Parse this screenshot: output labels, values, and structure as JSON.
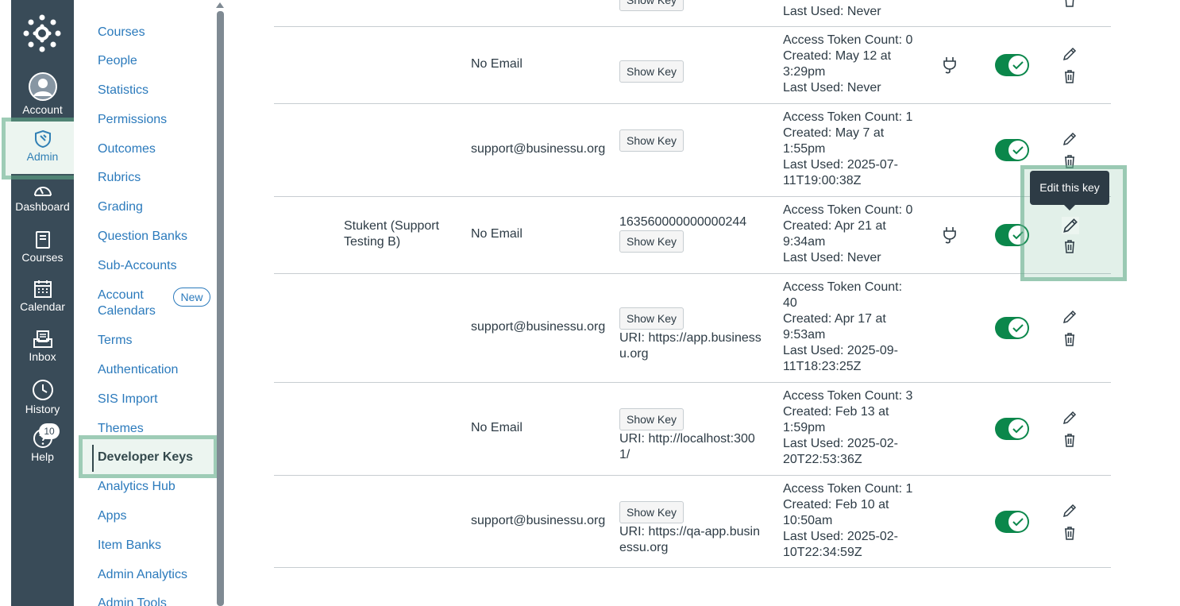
{
  "global_nav": {
    "items": [
      {
        "label": "Account",
        "icon": "account-icon"
      },
      {
        "label": "Admin",
        "icon": "admin-icon"
      },
      {
        "label": "Dashboard",
        "icon": "dashboard-icon"
      },
      {
        "label": "Courses",
        "icon": "courses-icon"
      },
      {
        "label": "Calendar",
        "icon": "calendar-icon"
      },
      {
        "label": "Inbox",
        "icon": "inbox-icon"
      },
      {
        "label": "History",
        "icon": "history-icon"
      },
      {
        "label": "Help",
        "icon": "help-icon"
      }
    ],
    "help_badge": "10",
    "nav_color": "#394b58",
    "link_color": "#2b7abc"
  },
  "admin_menu": {
    "items": [
      {
        "label": "Courses"
      },
      {
        "label": "People"
      },
      {
        "label": "Statistics"
      },
      {
        "label": "Permissions"
      },
      {
        "label": "Outcomes"
      },
      {
        "label": "Rubrics"
      },
      {
        "label": "Grading"
      },
      {
        "label": "Question Banks"
      },
      {
        "label": "Sub-Accounts"
      },
      {
        "label": "Account Calendars",
        "line1": "Account",
        "line2": "Calendars",
        "badge": "New"
      },
      {
        "label": "Terms"
      },
      {
        "label": "Authentication"
      },
      {
        "label": "SIS Import"
      },
      {
        "label": "Themes"
      },
      {
        "label": "Developer Keys"
      },
      {
        "label": "Analytics Hub"
      },
      {
        "label": "Apps"
      },
      {
        "label": "Item Banks"
      },
      {
        "label": "Admin Analytics"
      },
      {
        "label": "Admin Tools"
      }
    ],
    "active": "Developer Keys"
  },
  "keys_table": {
    "show_key_label": "Show Key",
    "tooltip": "Edit this key",
    "toggle_color": "#0b874b",
    "rows": [
      {
        "name": "",
        "email": "",
        "key_id": "",
        "redirect": "",
        "stats": [
          "Last Used: Never"
        ],
        "partial": true
      },
      {
        "name": "",
        "email": "No Email",
        "key_id": "",
        "redirect": "",
        "stats": [
          "Access Token Count: 0",
          "Created: May 12 at",
          "3:29pm",
          "Last Used: Never"
        ],
        "lti": true
      },
      {
        "name": "",
        "email": "support@businessu.org",
        "key_id": "",
        "redirect": "",
        "stats": [
          "Access Token Count: 1",
          "Created: May 7 at",
          "1:55pm",
          "Last Used: 2025-07-",
          "11T19:00:38Z"
        ],
        "lti": false
      },
      {
        "name": "Stukent (Support Testing B)",
        "name_line1": "Stukent (Support",
        "name_line2": "Testing B)",
        "email": "No Email",
        "key_id": "163560000000000244",
        "redirect": "",
        "stats": [
          "Access Token Count: 0",
          "Created: Apr 21 at",
          "9:34am",
          "Last Used: Never"
        ],
        "lti": true
      },
      {
        "name": "",
        "email": "support@businessu.org",
        "key_id": "",
        "redirect_line1": "URI: https://app.business",
        "redirect_line2": "u.org",
        "stats": [
          "Access Token Count:",
          "40",
          "Created: Apr 17 at",
          "9:53am",
          "Last Used: 2025-09-",
          "11T18:23:25Z"
        ],
        "lti": false
      },
      {
        "name": "",
        "email": "No Email",
        "key_id": "",
        "redirect_line1": "URI: http://localhost:300",
        "redirect_line2": "1/",
        "stats": [
          "Access Token Count: 3",
          "Created: Feb 13 at",
          "1:59pm",
          "Last Used: 2025-02-",
          "20T22:53:36Z"
        ],
        "lti": false
      },
      {
        "name": "",
        "email": "support@businessu.org",
        "key_id": "",
        "redirect_line1": "URI: https://qa-app.busin",
        "redirect_line2": "essu.org",
        "stats": [
          "Access Token Count: 1",
          "Created: Feb 10 at",
          "10:50am",
          "Last Used: 2025-02-",
          "10T22:34:59Z"
        ],
        "lti": false
      }
    ]
  }
}
